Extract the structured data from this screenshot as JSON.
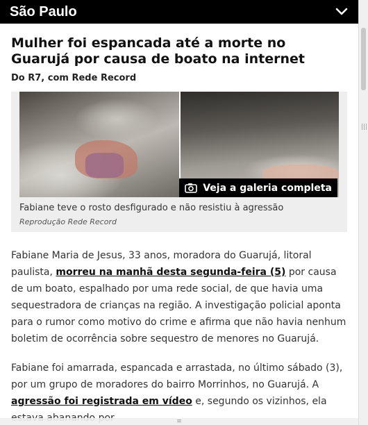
{
  "header": {
    "section_title": "São Paulo",
    "toggle_icon": "chevron-down-icon"
  },
  "article": {
    "headline": "Mulher foi espancada até a morte no Guarujá por causa de boato na internet",
    "byline": "Do R7, com Rede Record",
    "figure": {
      "gallery_label": "Veja a galeria completa",
      "gallery_icon": "camera-icon",
      "caption": "Fabiane teve o rosto desfigurado e não resistiu à agressão",
      "credit": "Reprodução Rede Record"
    },
    "paragraph1": {
      "text_a": "Fabiane Maria de Jesus, 33 anos, moradora do Guarujá, litoral paulista, ",
      "link": "morreu na manhã desta segunda-feira (5)",
      "text_b": " por causa de um boato, espalhado por uma rede social, de que havia uma sequestradora de crianças na região. A investigação policial aponta para o rumor como motivo do crime e afirma que não havia nenhum boletim de ocorrência sobre sequestro de menores no Guarujá."
    },
    "paragraph2": {
      "text_a": "Fabiane foi amarrada, espancada e arrastada, no último sábado (3), por um grupo de moradores do bairro Morrinhos, no Guarujá. A ",
      "link": "agressão foi registrada em vídeo",
      "text_b": " e, segundo os vizinhos, ela estava abanando por"
    }
  },
  "colors": {
    "header_bg": "#000000",
    "header_text": "#ffffff",
    "figure_bg": "#eeeeee"
  }
}
